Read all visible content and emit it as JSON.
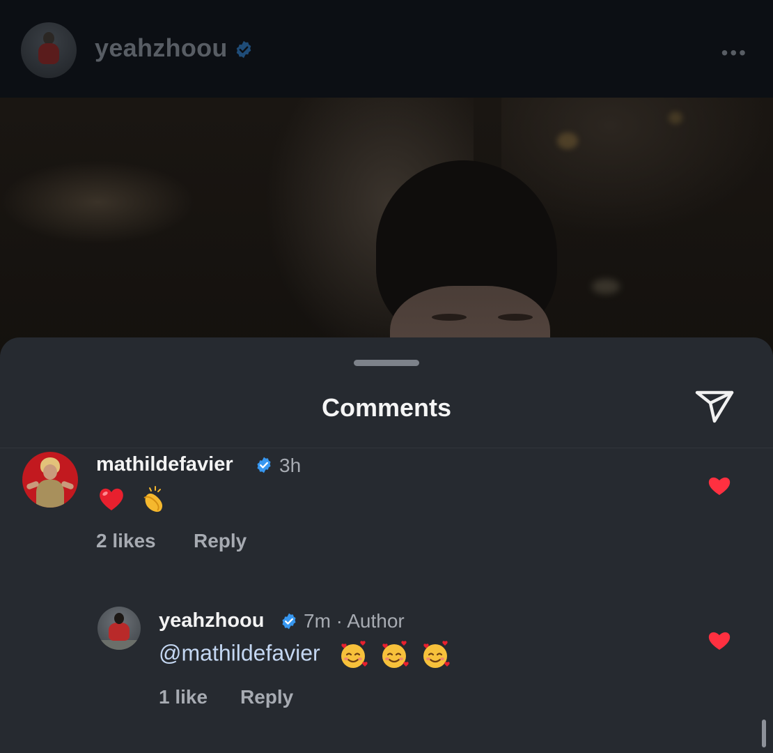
{
  "post": {
    "username": "yeahzhoou",
    "more_icon": "more-horizontal-icon",
    "more_glyph": "•••"
  },
  "sheet": {
    "title": "Comments",
    "share_icon": "send-icon"
  },
  "comments": [
    {
      "username": "mathildefavier",
      "verified": true,
      "time": "3h",
      "emojis": [
        "red-heart-emoji",
        "clapping-hands-emoji"
      ],
      "likes": "2 likes",
      "reply_label": "Reply",
      "liked": true
    },
    {
      "username": "yeahzhoou",
      "verified": true,
      "time": "7m · Author",
      "mention": "@mathildefavier",
      "emojis": [
        "smiling-face-with-hearts-emoji",
        "smiling-face-with-hearts-emoji",
        "smiling-face-with-hearts-emoji"
      ],
      "likes": "1 like",
      "reply_label": "Reply",
      "liked": true
    }
  ],
  "colors": {
    "verified_blue": "#3797f0",
    "like_red": "#ff3040",
    "sheet_bg": "#262a30",
    "mention_blue": "#c4d7f2"
  }
}
